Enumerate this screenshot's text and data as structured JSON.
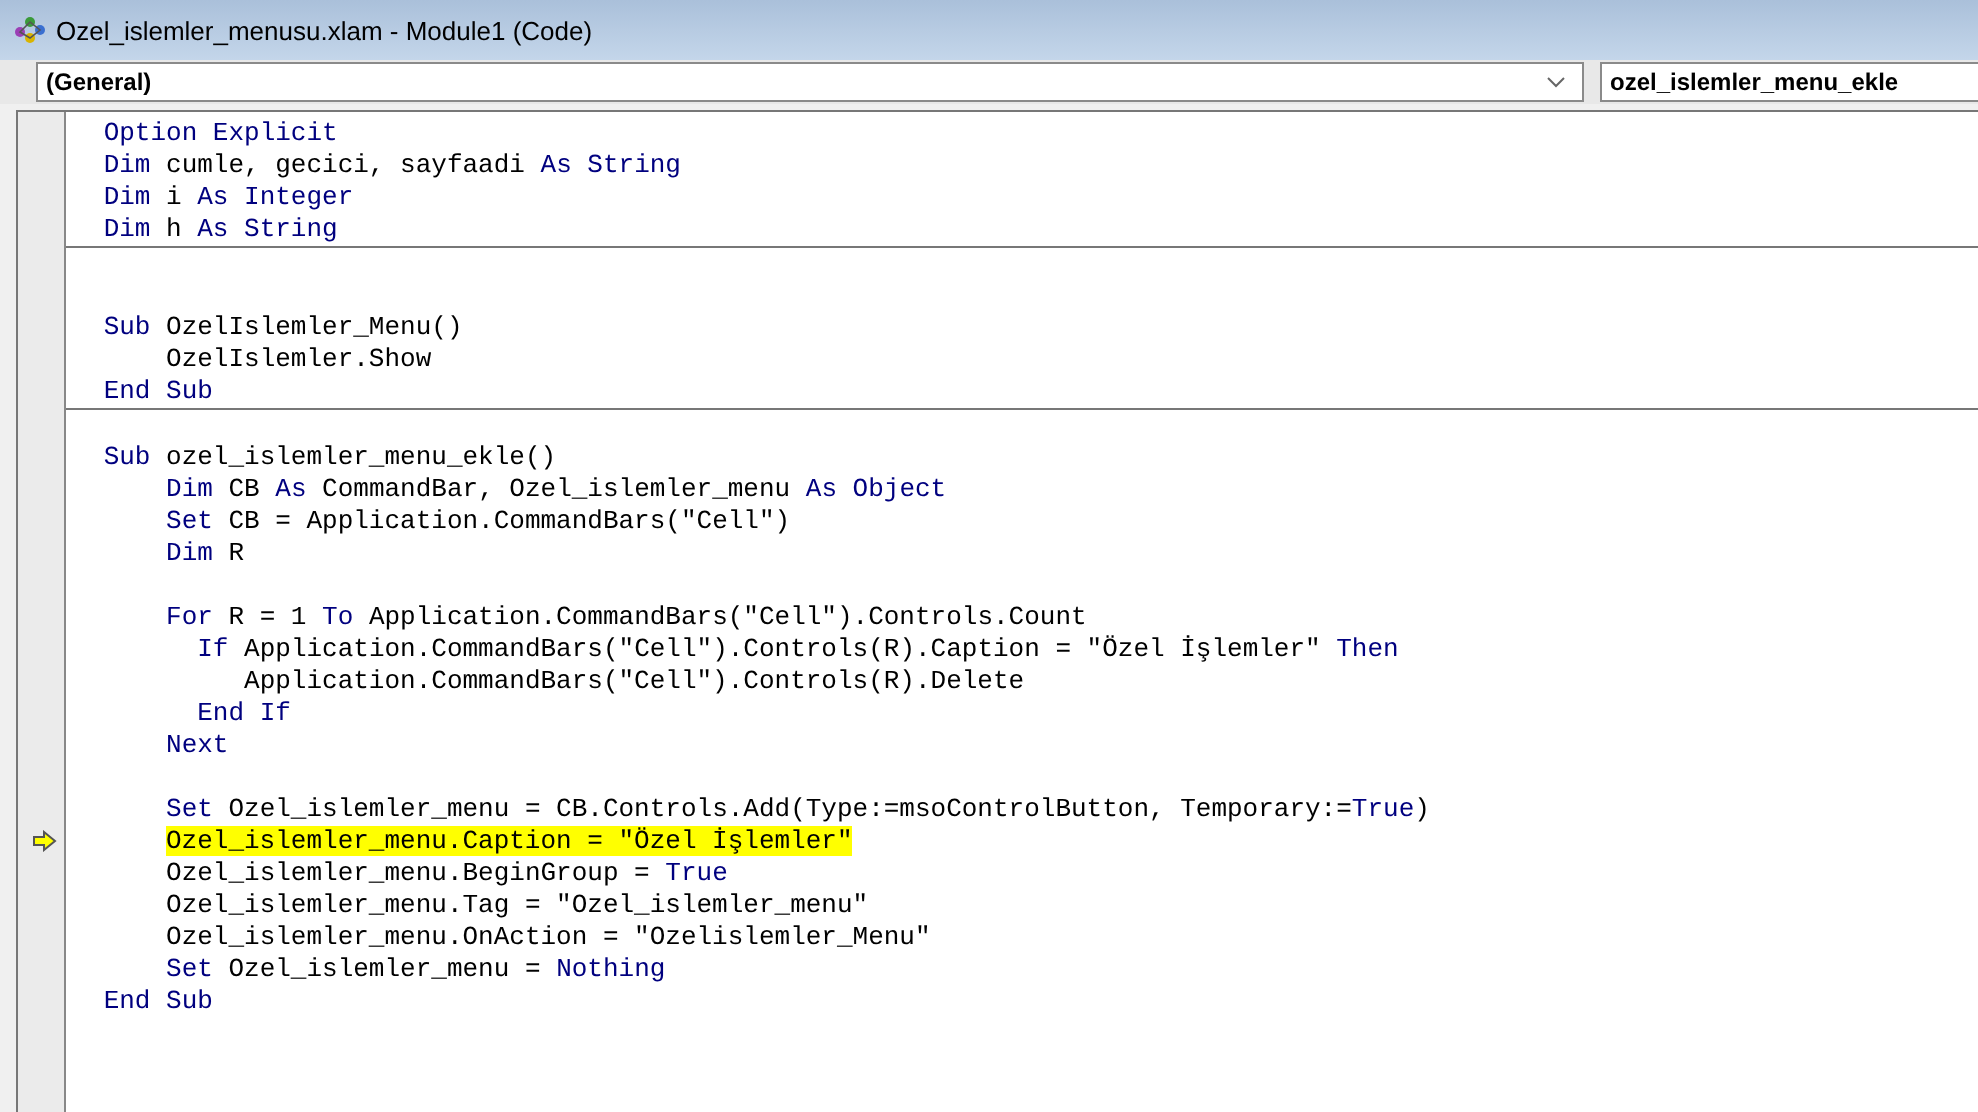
{
  "window": {
    "title": "Ozel_islemler_menusu.xlam - Module1 (Code)"
  },
  "object_box": {
    "value": "(General)"
  },
  "procedure_box": {
    "value": "ozel_islemler_menu_ekle"
  },
  "procedures": [
    {
      "lines": [
        {
          "kind": "code",
          "current": false,
          "segments": [
            {
              "kind": "keyword",
              "text": "Option Explicit"
            }
          ]
        },
        {
          "kind": "code",
          "current": false,
          "segments": [
            {
              "kind": "keyword",
              "text": "Dim"
            },
            {
              "kind": "plain",
              "text": " cumle, gecici, sayfaadi "
            },
            {
              "kind": "keyword",
              "text": "As String"
            }
          ]
        },
        {
          "kind": "code",
          "current": false,
          "segments": [
            {
              "kind": "keyword",
              "text": "Dim"
            },
            {
              "kind": "plain",
              "text": " i "
            },
            {
              "kind": "keyword",
              "text": "As Integer"
            }
          ]
        },
        {
          "kind": "code",
          "current": false,
          "segments": [
            {
              "kind": "keyword",
              "text": "Dim"
            },
            {
              "kind": "plain",
              "text": " h "
            },
            {
              "kind": "keyword",
              "text": "As String"
            }
          ]
        }
      ]
    },
    {
      "lines": [
        {
          "kind": "blank"
        },
        {
          "kind": "blank"
        },
        {
          "kind": "code",
          "current": false,
          "segments": [
            {
              "kind": "keyword",
              "text": "Sub"
            },
            {
              "kind": "plain",
              "text": " OzelIslemler_Menu()"
            }
          ]
        },
        {
          "kind": "code",
          "current": false,
          "segments": [
            {
              "kind": "plain",
              "text": "    OzelIslemler.Show"
            }
          ]
        },
        {
          "kind": "code",
          "current": false,
          "segments": [
            {
              "kind": "keyword",
              "text": "End Sub"
            }
          ]
        }
      ]
    },
    {
      "lines": [
        {
          "kind": "blank"
        },
        {
          "kind": "code",
          "current": false,
          "segments": [
            {
              "kind": "keyword",
              "text": "Sub"
            },
            {
              "kind": "plain",
              "text": " ozel_islemler_menu_ekle()"
            }
          ]
        },
        {
          "kind": "code",
          "current": false,
          "segments": [
            {
              "kind": "keyword",
              "text": "    Dim"
            },
            {
              "kind": "plain",
              "text": " CB "
            },
            {
              "kind": "keyword",
              "text": "As"
            },
            {
              "kind": "plain",
              "text": " CommandBar, Ozel_islemler_menu "
            },
            {
              "kind": "keyword",
              "text": "As Object"
            }
          ]
        },
        {
          "kind": "code",
          "current": false,
          "segments": [
            {
              "kind": "keyword",
              "text": "    Set"
            },
            {
              "kind": "plain",
              "text": " CB = Application.CommandBars(\"Cell\")"
            }
          ]
        },
        {
          "kind": "code",
          "current": false,
          "segments": [
            {
              "kind": "keyword",
              "text": "    Dim"
            },
            {
              "kind": "plain",
              "text": " R"
            }
          ]
        },
        {
          "kind": "blank"
        },
        {
          "kind": "code",
          "current": false,
          "segments": [
            {
              "kind": "keyword",
              "text": "    For"
            },
            {
              "kind": "plain",
              "text": " R = 1 "
            },
            {
              "kind": "keyword",
              "text": "To"
            },
            {
              "kind": "plain",
              "text": " Application.CommandBars(\"Cell\").Controls.Count"
            }
          ]
        },
        {
          "kind": "code",
          "current": false,
          "segments": [
            {
              "kind": "keyword",
              "text": "      If"
            },
            {
              "kind": "plain",
              "text": " Application.CommandBars(\"Cell\").Controls(R).Caption = \"Özel İşlemler\" "
            },
            {
              "kind": "keyword",
              "text": "Then"
            }
          ]
        },
        {
          "kind": "code",
          "current": false,
          "segments": [
            {
              "kind": "plain",
              "text": "         Application.CommandBars(\"Cell\").Controls(R).Delete"
            }
          ]
        },
        {
          "kind": "code",
          "current": false,
          "segments": [
            {
              "kind": "keyword",
              "text": "      End If"
            }
          ]
        },
        {
          "kind": "code",
          "current": false,
          "segments": [
            {
              "kind": "keyword",
              "text": "    Next"
            }
          ]
        },
        {
          "kind": "blank"
        },
        {
          "kind": "code",
          "current": false,
          "segments": [
            {
              "kind": "keyword",
              "text": "    Set"
            },
            {
              "kind": "plain",
              "text": " Ozel_islemler_menu = CB.Controls.Add(Type:=msoControlButton, Temporary:="
            },
            {
              "kind": "keyword",
              "text": "True"
            },
            {
              "kind": "plain",
              "text": ")"
            }
          ]
        },
        {
          "kind": "code",
          "current": true,
          "segments": [
            {
              "kind": "plain",
              "text": "Ozel_islemler_menu.Caption = \"Özel İşlemler\""
            }
          ]
        },
        {
          "kind": "code",
          "current": false,
          "segments": [
            {
              "kind": "plain",
              "text": "    Ozel_islemler_menu.BeginGroup = "
            },
            {
              "kind": "keyword",
              "text": "True"
            }
          ]
        },
        {
          "kind": "code",
          "current": false,
          "segments": [
            {
              "kind": "plain",
              "text": "    Ozel_islemler_menu.Tag = \"Ozel_islemler_menu\""
            }
          ]
        },
        {
          "kind": "code",
          "current": false,
          "segments": [
            {
              "kind": "plain",
              "text": "    Ozel_islemler_menu.OnAction = \"Ozelislemler_Menu\""
            }
          ]
        },
        {
          "kind": "code",
          "current": false,
          "segments": [
            {
              "kind": "keyword",
              "text": "    Set"
            },
            {
              "kind": "plain",
              "text": " Ozel_islemler_menu = "
            },
            {
              "kind": "keyword",
              "text": "Nothing"
            }
          ]
        },
        {
          "kind": "code",
          "current": false,
          "segments": [
            {
              "kind": "keyword",
              "text": "End Sub"
            }
          ]
        }
      ]
    }
  ]
}
